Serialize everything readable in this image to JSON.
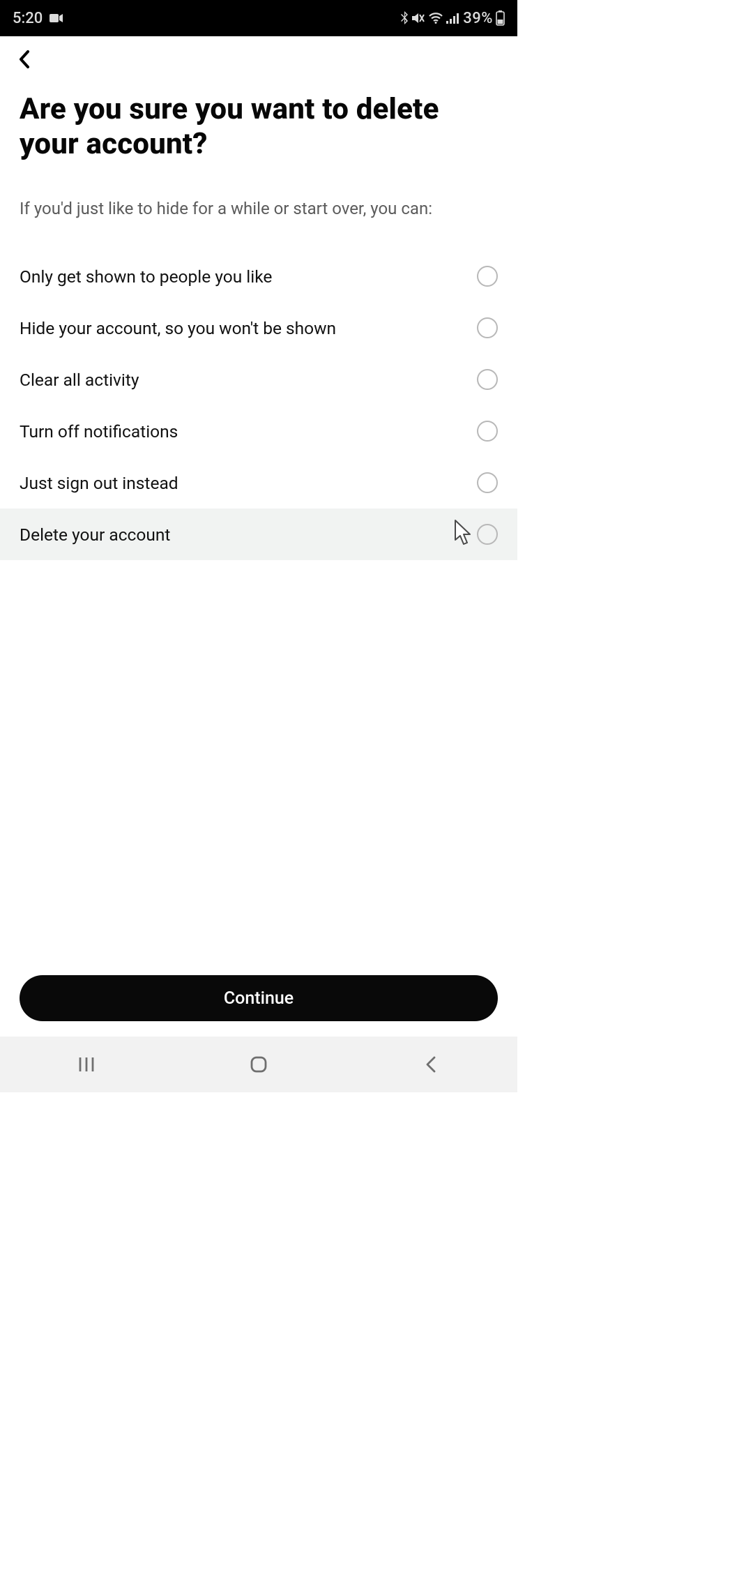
{
  "status": {
    "time": "5:20",
    "battery": "39%"
  },
  "page": {
    "title": "Are you sure you want to delete your account?",
    "subtitle": "If you'd just like to hide for a while or start over, you can:"
  },
  "options": [
    {
      "label": "Only get shown to people you like",
      "selected": false
    },
    {
      "label": "Hide your account, so you won't be shown",
      "selected": false
    },
    {
      "label": "Clear all activity",
      "selected": false
    },
    {
      "label": "Turn off notifications",
      "selected": false
    },
    {
      "label": "Just sign out instead",
      "selected": false
    },
    {
      "label": "Delete your account",
      "selected": false,
      "highlight": true
    }
  ],
  "buttons": {
    "continue": "Continue"
  }
}
